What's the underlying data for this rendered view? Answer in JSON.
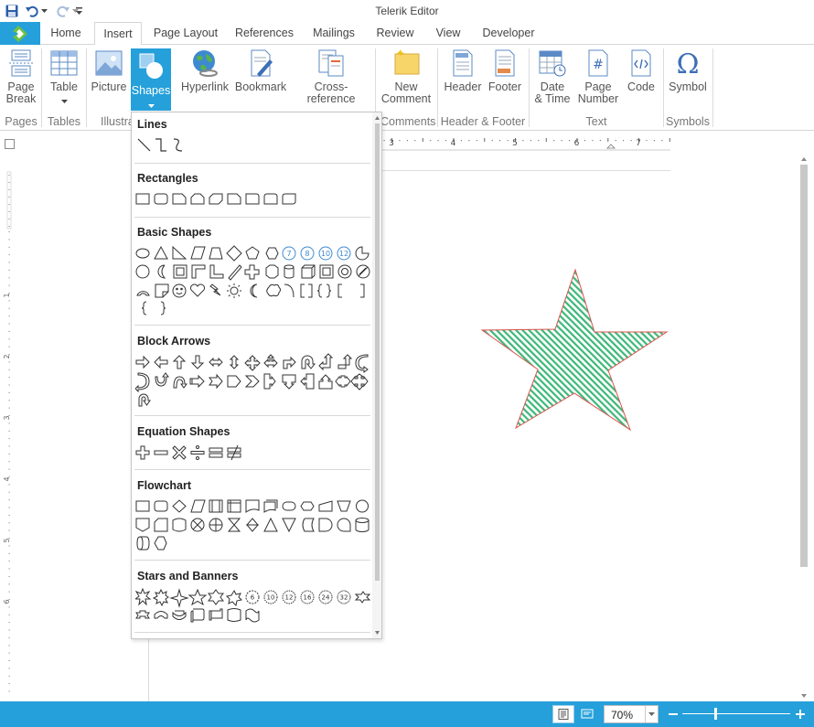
{
  "window": {
    "title": "Telerik Editor"
  },
  "quick_access": [
    "save-icon",
    "undo-icon",
    "undo-dropdown-icon",
    "redo-icon",
    "redo-dropdown-icon",
    "customize-qat-icon"
  ],
  "tabs": [
    {
      "label": "Home",
      "active": false
    },
    {
      "label": "Insert",
      "active": true
    },
    {
      "label": "Page Layout",
      "active": false
    },
    {
      "label": "References",
      "active": false
    },
    {
      "label": "Mailings",
      "active": false
    },
    {
      "label": "Review",
      "active": false
    },
    {
      "label": "View",
      "active": false
    },
    {
      "label": "Developer",
      "active": false
    }
  ],
  "ribbon": {
    "page_break": "Page\nBreak",
    "table": "Table",
    "picture": "Picture",
    "shapes": "Shapes",
    "hyperlink": "Hyperlink",
    "bookmark": "Bookmark",
    "cross_reference": "Cross-reference",
    "new_comment": "New\nComment",
    "header": "Header",
    "footer": "Footer",
    "date_time": "Date\n& Time",
    "page_number": "Page\nNumber",
    "code": "Code",
    "symbol": "Symbol",
    "groups": {
      "pages": "Pages",
      "tables": "Tables",
      "illustrations": "Illustra",
      "comments": "Comments",
      "header_footer": "Header & Footer",
      "text": "Text",
      "symbols": "Symbols"
    }
  },
  "shapes_menu": {
    "categories": {
      "lines": "Lines",
      "rectangles": "Rectangles",
      "basic_shapes": "Basic Shapes",
      "block_arrows": "Block Arrows",
      "equation_shapes": "Equation Shapes",
      "flowchart": "Flowchart",
      "stars_banners": "Stars and Banners"
    },
    "basic_numbers": [
      "7",
      "8",
      "10",
      "12"
    ],
    "star_numbers": [
      "6",
      "10",
      "12",
      "16",
      "24",
      "32"
    ]
  },
  "ruler": {
    "labels": [
      "3",
      "4",
      "5",
      "6",
      "7"
    ]
  },
  "vruler": {
    "labels": [
      "1",
      "2",
      "3",
      "4",
      "5",
      "6"
    ]
  },
  "document": {
    "star": {
      "fill": "#3cb878",
      "stroke": "#d9534f"
    }
  },
  "statusbar": {
    "zoom": "70%"
  },
  "colors": {
    "accent": "#25a0da"
  }
}
